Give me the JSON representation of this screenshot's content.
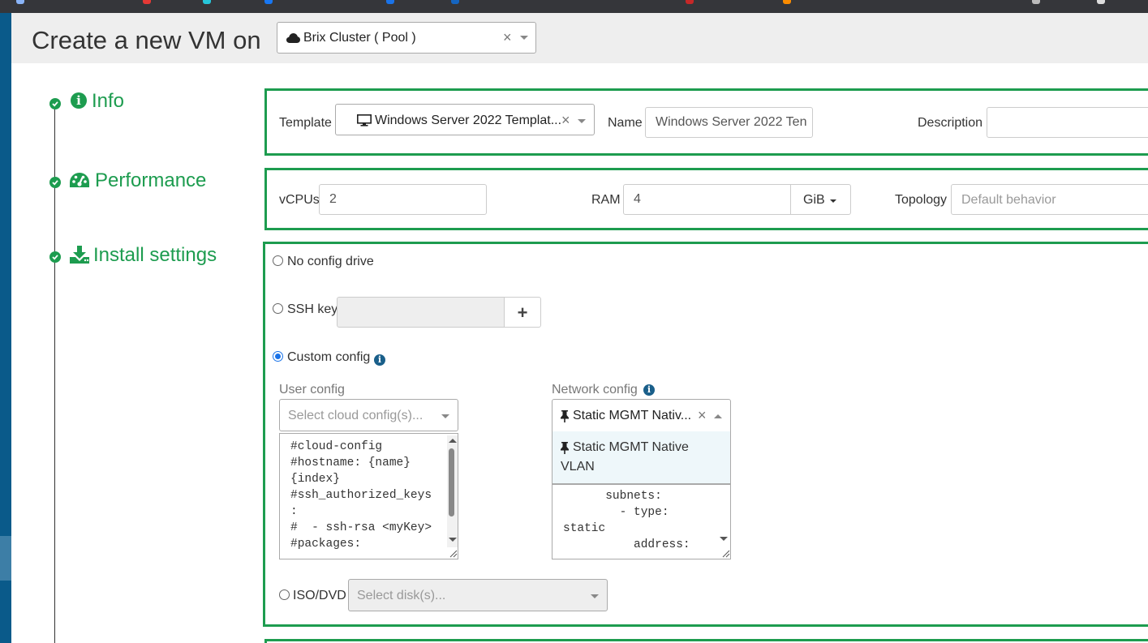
{
  "header": {
    "title": "Create a new VM on",
    "pool": "Brix Cluster ( Pool )",
    "clear": "×"
  },
  "sections": {
    "info": "Info",
    "performance": "Performance",
    "install": "Install settings"
  },
  "info": {
    "template_label": "Template",
    "template_value": "Windows Server 2022 Templat...",
    "name_label": "Name",
    "name_value": "Windows Server 2022 Ten",
    "description_label": "Description",
    "description_value": ""
  },
  "performance": {
    "vcpus_label": "vCPUs",
    "vcpus_value": "2",
    "ram_label": "RAM",
    "ram_value": "4",
    "ram_unit": "GiB",
    "topology_label": "Topology",
    "topology_placeholder": "Default behavior"
  },
  "install": {
    "no_config_label": "No config drive",
    "ssh_key_label": "SSH key",
    "ssh_add": "+",
    "custom_config_label": "Custom config",
    "user_config_label": "User config",
    "user_config_placeholder": "Select cloud config(s)...",
    "user_config_lines": [
      "#cloud-config",
      "#hostname: {name}",
      "{index}",
      "#ssh_authorized_keys",
      ":",
      "#  - ssh-rsa <myKey>",
      "#packages:"
    ],
    "network_config_label": "Network config",
    "network_config_value": "Static MGMT Nativ...",
    "network_dropdown_option_line1": "Static MGMT Native",
    "network_dropdown_option_line2": "VLAN",
    "network_config_lines": [
      "      subnets:",
      "        - type:",
      "static",
      "          address:"
    ],
    "iso_label": "ISO/DVD",
    "iso_placeholder": "Select disk(s)..."
  },
  "selected_install_mode": "Custom config",
  "colors": {
    "accent_green": "#1d9c4f",
    "header_bg": "#eeeeee",
    "sidebar_blue": "#0a5a8a"
  }
}
